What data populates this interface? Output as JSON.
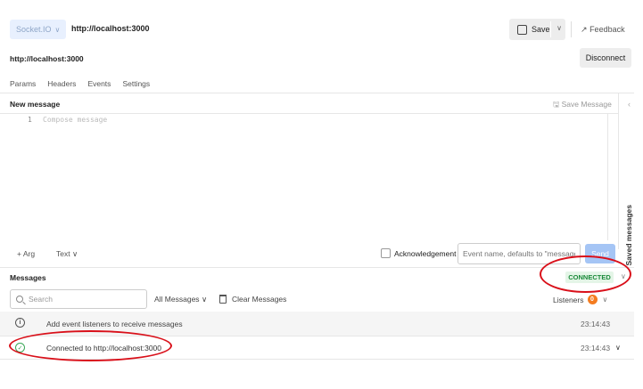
{
  "header": {
    "protocol": "Socket.IO",
    "url": "http://localhost:3000",
    "save_label": "Save",
    "feedback_label": "Feedback"
  },
  "connection": {
    "url": "http://localhost:3000",
    "disconnect_label": "Disconnect"
  },
  "tabs": [
    {
      "label": "Params"
    },
    {
      "label": "Headers"
    },
    {
      "label": "Events"
    },
    {
      "label": "Settings"
    }
  ],
  "composer": {
    "title": "New message",
    "save_message_label": "Save Message",
    "line_number": "1",
    "placeholder": "Compose message",
    "saved_messages_label": "Saved messages",
    "add_arg_label": "+ Arg",
    "format_label": "Text",
    "ack_label": "Acknowledgement",
    "event_placeholder": "Event name, defaults to \"message\"",
    "send_label": "Send"
  },
  "messages": {
    "title": "Messages",
    "status": "CONNECTED",
    "search_placeholder": "Search",
    "filter_label": "All Messages",
    "clear_label": "Clear Messages",
    "listeners_label": "Listeners",
    "listeners_count": "0",
    "rows": [
      {
        "text": "Add event listeners to receive messages",
        "time": "23:14:43"
      },
      {
        "text": "Connected to http://localhost:3000",
        "time": "23:14:43"
      }
    ]
  },
  "colors": {
    "accent": "#a5c5f5",
    "connected_bg": "#e4f5e7",
    "connected_text": "#1a8a3a",
    "listener_badge": "#f47c20",
    "annotation": "#d9101a"
  }
}
